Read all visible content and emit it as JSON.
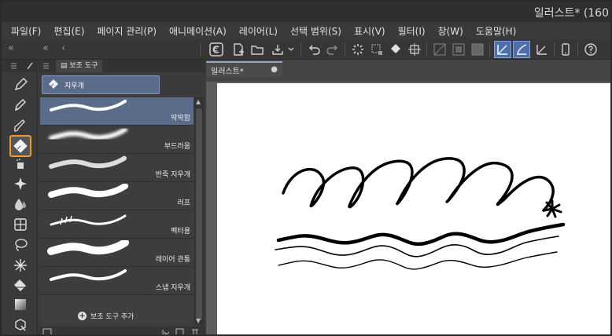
{
  "titlebar": {
    "title": "일러스트* (160"
  },
  "menu": [
    {
      "label": "파일(F)"
    },
    {
      "label": "편집(E)"
    },
    {
      "label": "페이지 관리(P)"
    },
    {
      "label": "애니메이션(A)"
    },
    {
      "label": "레이어(L)"
    },
    {
      "label": "선택 범위(S)"
    },
    {
      "label": "표시(V)"
    },
    {
      "label": "필터(I)"
    },
    {
      "label": "창(W)"
    },
    {
      "label": "도움말(H)"
    }
  ],
  "command_bar": {
    "collapse_left": "«",
    "collapse_right": "«"
  },
  "subtool_panel": {
    "tab_title": "보조 도구",
    "group_label": "지우개",
    "brushes": [
      {
        "name": "딱딱함"
      },
      {
        "name": "부드러움"
      },
      {
        "name": "반죽 지우개"
      },
      {
        "name": "러프"
      },
      {
        "name": "벡터용"
      },
      {
        "name": "레이어 관통"
      },
      {
        "name": "스냅 지우개"
      }
    ],
    "add_subtool_label": "보조 도구 추가"
  },
  "canvas": {
    "doc_tab_label": "일러스트*",
    "doc_tab_dot": "●"
  },
  "colors": {
    "accent": "#f29b2a",
    "selection": "#5b6b8a",
    "canvas_bg": "#5d5d5d"
  }
}
